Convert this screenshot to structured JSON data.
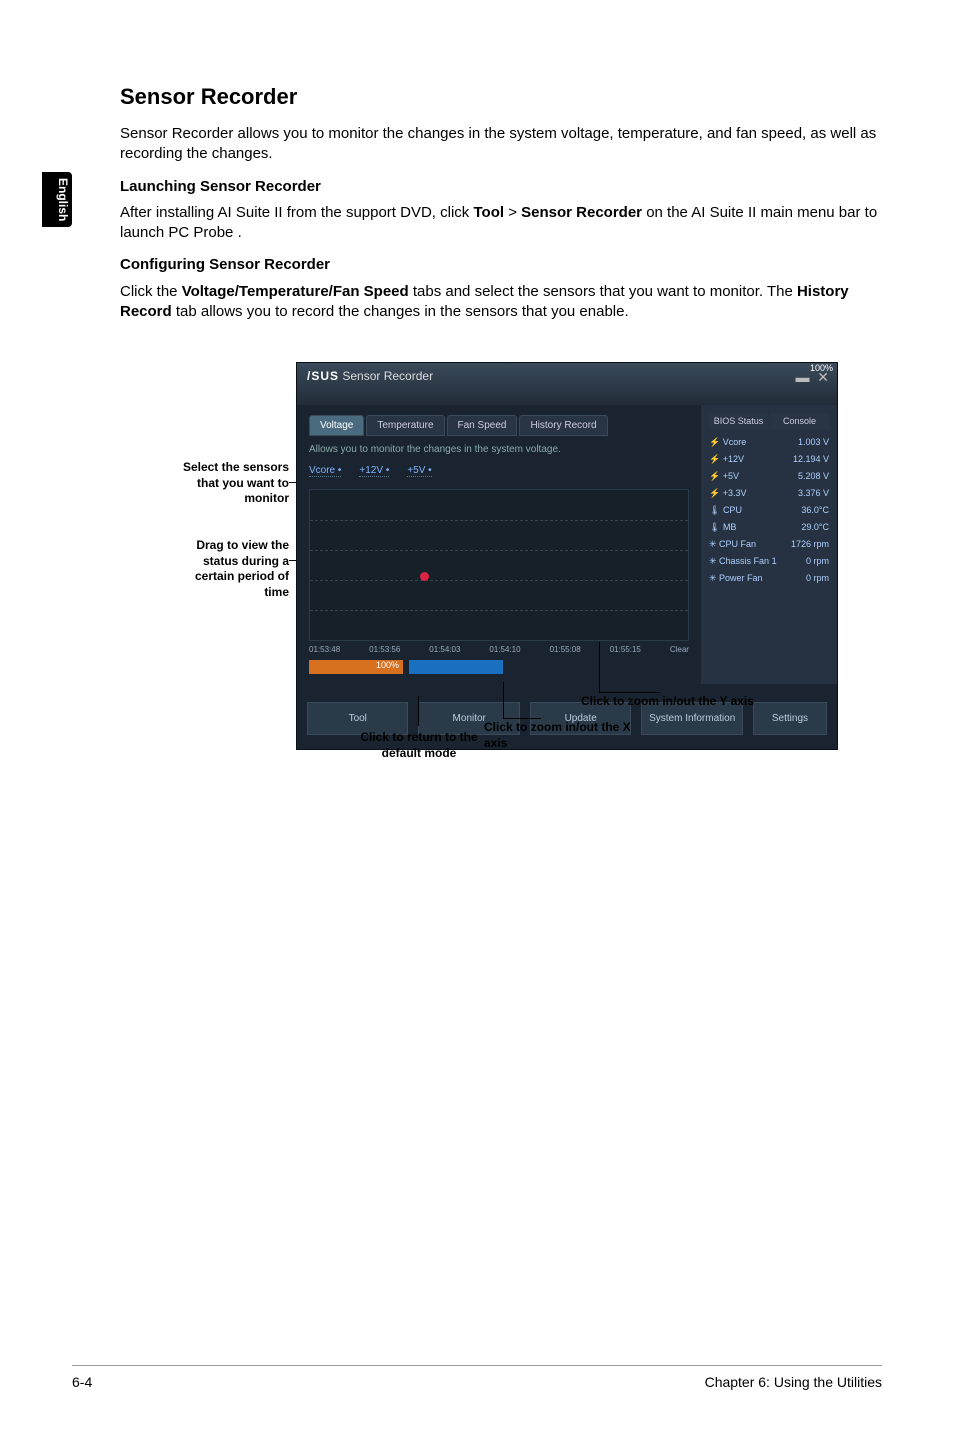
{
  "sideTab": "English",
  "title": "Sensor Recorder",
  "intro": "Sensor Recorder allows you to monitor the changes in the system voltage, temperature, and fan speed, as well as recording the changes.",
  "launch": {
    "heading": "Launching Sensor Recorder",
    "text_pre": "After installing AI Suite II from the support DVD, click ",
    "tool": "Tool",
    "gt": " > ",
    "sr": "Sensor Recorder",
    "text_post": " on the AI Suite II main menu bar to launch PC Probe ."
  },
  "config": {
    "heading": "Configuring Sensor Recorder",
    "text_pre": "Click the ",
    "b1": "Voltage/Temperature/Fan Speed",
    "text_mid": " tabs and select the sensors that you want to monitor. The ",
    "b2": "History Record",
    "text_post": " tab allows you to record the changes in the sensors that you enable."
  },
  "callouts": {
    "select": "Select the sensors that you want to monitor",
    "drag": "Drag to view the status during a certain period of time",
    "ret": "Click to return to the default mode",
    "zx": "Click to zoom in/out the X axis",
    "zy": "Click to zoom in/out the Y axis"
  },
  "app": {
    "brand": "/SUS",
    "winTitle": "Sensor Recorder",
    "tabs": [
      "Voltage",
      "Temperature",
      "Fan Speed",
      "History Record"
    ],
    "hint": "Allows you to monitor the changes in the system voltage.",
    "sensors": [
      "Vcore •",
      "+12V •",
      "+5V •"
    ],
    "xticks": [
      "01:53:48",
      "01:53:56",
      "01:54:03",
      "01:54:10",
      "01:55:08",
      "01:55:15"
    ],
    "zoomx": "100%",
    "zoomy": "100%",
    "clear": "Clear",
    "btns": [
      "Tool",
      "Monitor",
      "Update",
      "System Information",
      "Settings"
    ],
    "sideTabs": [
      "BIOS Status",
      "Console"
    ],
    "readings": [
      {
        "name": "Vcore",
        "val": "1.003 V"
      },
      {
        "name": "+12V",
        "val": "12.194 V"
      },
      {
        "name": "+5V",
        "val": "5.208 V"
      },
      {
        "name": "+3.3V",
        "val": "3.376 V"
      },
      {
        "name": "CPU",
        "val": "36.0°C"
      },
      {
        "name": "MB",
        "val": "29.0°C"
      },
      {
        "name": "CPU Fan",
        "val": "1726 rpm"
      },
      {
        "name": "Chassis Fan 1",
        "val": "0 rpm"
      },
      {
        "name": "Power Fan",
        "val": "0 rpm"
      }
    ]
  },
  "footer": {
    "left": "6-4",
    "right": "Chapter 6: Using the Utilities"
  }
}
